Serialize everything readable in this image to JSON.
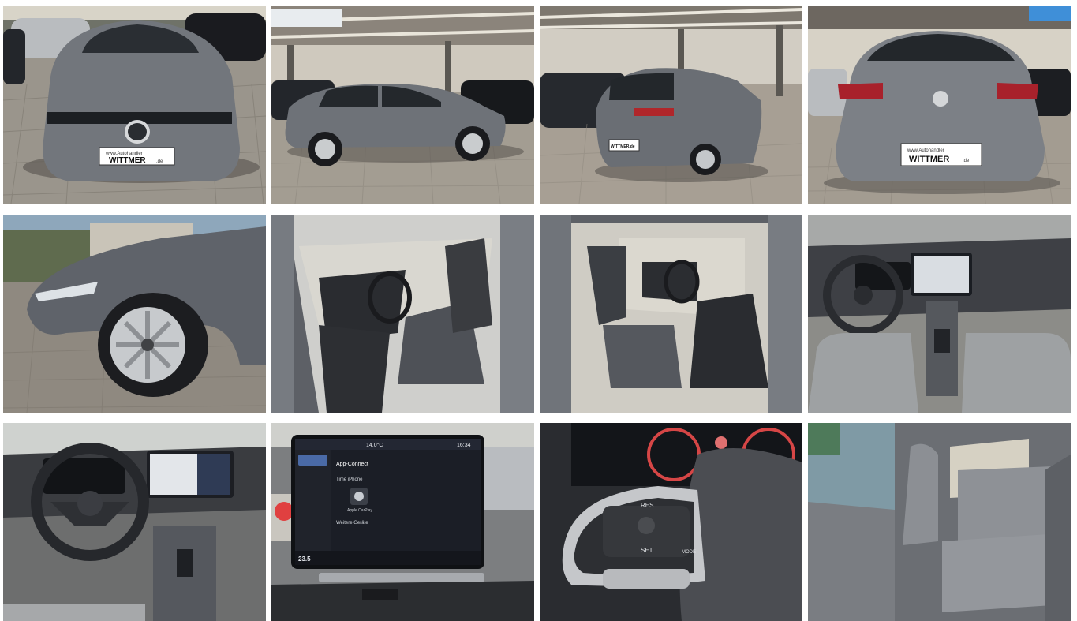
{
  "gallery": {
    "photos": [
      {
        "name": "front-view-photo",
        "plate_line1": "www.Autohandler",
        "plate_line2": "WITTMER",
        "plate_line3": ".de"
      },
      {
        "name": "side-profile-photo"
      },
      {
        "name": "rear-three-quarter-photo",
        "plate_line1": "WITTMER.de"
      },
      {
        "name": "rear-view-photo",
        "plate_line1": "www.Autohandler",
        "plate_line2": "WITTMER",
        "plate_line3": ".de"
      },
      {
        "name": "front-wheel-photo"
      },
      {
        "name": "driver-door-interior-photo"
      },
      {
        "name": "passenger-door-interior-photo"
      },
      {
        "name": "dashboard-overview-photo"
      },
      {
        "name": "cockpit-steering-photo"
      },
      {
        "name": "infotainment-screen-photo",
        "status_time": "16:34",
        "status_temp": "14,0°C",
        "app_title": "App-Connect",
        "device_label": "Time iPhone",
        "carplay_label": "Apple CarPlay",
        "more_label": "Weitere Geräte",
        "climate_temp": "23.5"
      },
      {
        "name": "steering-wheel-buttons-photo",
        "btn_res": "RES",
        "btn_set": "SET",
        "btn_mode": "MODE"
      },
      {
        "name": "rear-seats-photo"
      }
    ]
  }
}
